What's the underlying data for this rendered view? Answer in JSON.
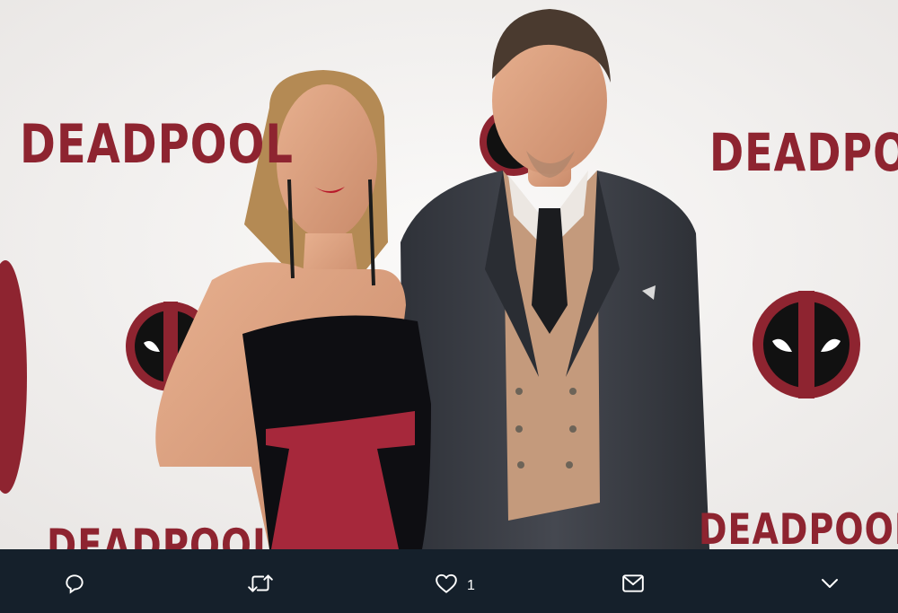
{
  "media": {
    "backdrop_logo_text": "DEADPOOL",
    "colors": {
      "backdrop": "#f3f1ef",
      "logo_red": "#8e2430",
      "suit": "#3a3d45",
      "vest": "#c49a7c",
      "sash": "#a6283b",
      "dress": "#0e0e12"
    }
  },
  "actions": {
    "reply_icon": "reply-icon",
    "retweet_icon": "retweet-icon",
    "like_icon": "heart-icon",
    "like_count": "1",
    "message_icon": "envelope-icon",
    "more_icon": "chevron-down-icon"
  },
  "colors": {
    "action_bar_bg": "#15202b",
    "icon": "#ffffff"
  }
}
